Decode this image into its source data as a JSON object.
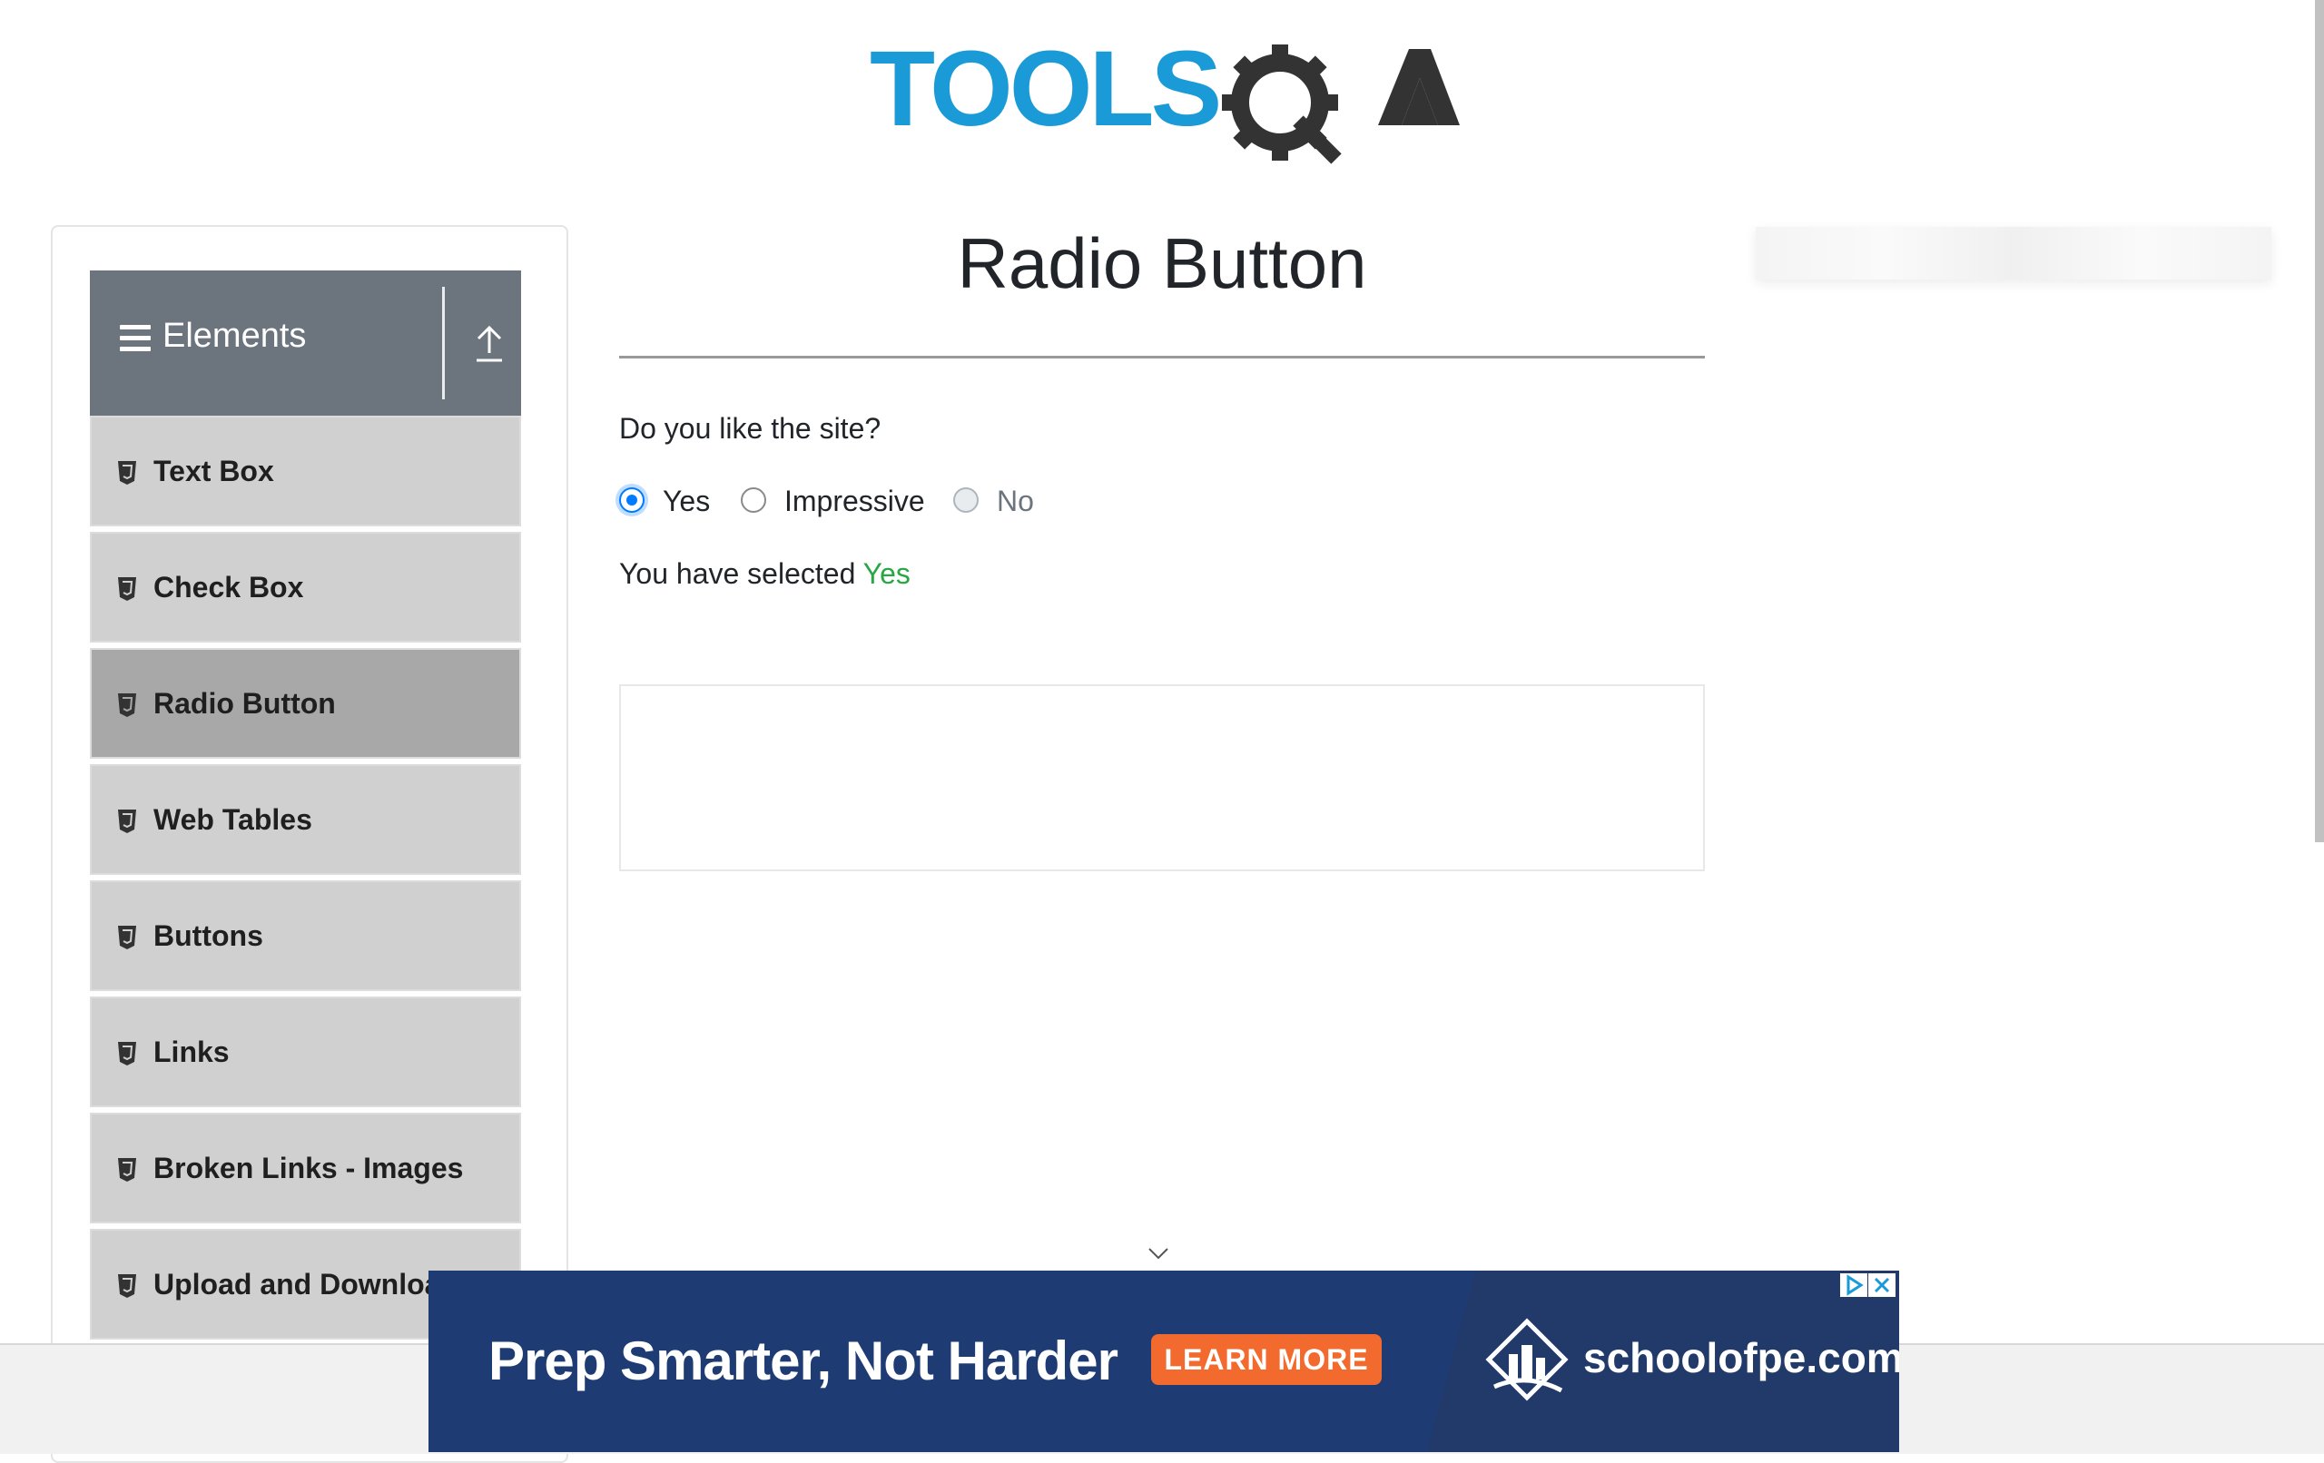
{
  "header": {
    "logo_text_primary": "TOOLS",
    "logo_text_secondary": "QA"
  },
  "sidebar": {
    "group_label": "Elements",
    "items": [
      {
        "label": "Text Box",
        "active": false
      },
      {
        "label": "Check Box",
        "active": false
      },
      {
        "label": "Radio Button",
        "active": true
      },
      {
        "label": "Web Tables",
        "active": false
      },
      {
        "label": "Buttons",
        "active": false
      },
      {
        "label": "Links",
        "active": false
      },
      {
        "label": "Broken Links - Images",
        "active": false
      },
      {
        "label": "Upload and Download",
        "active": false
      }
    ]
  },
  "main": {
    "title": "Radio Button",
    "question": "Do you like the site?",
    "options": [
      {
        "label": "Yes",
        "checked": true,
        "disabled": false
      },
      {
        "label": "Impressive",
        "checked": false,
        "disabled": false
      },
      {
        "label": "No",
        "checked": false,
        "disabled": true
      }
    ],
    "result_prefix": "You have selected",
    "result_value": "Yes"
  },
  "banner": {
    "headline": "Prep Smarter, Not Harder",
    "cta": "LEARN MORE",
    "domain": "schoolofpe.com"
  },
  "colors": {
    "brand_blue": "#1a9bd7",
    "brand_dark": "#333333",
    "sidebar_header": "#6c757d",
    "success": "#28a745",
    "banner_bg": "#1f3b73",
    "cta_orange": "#f26a2e"
  }
}
